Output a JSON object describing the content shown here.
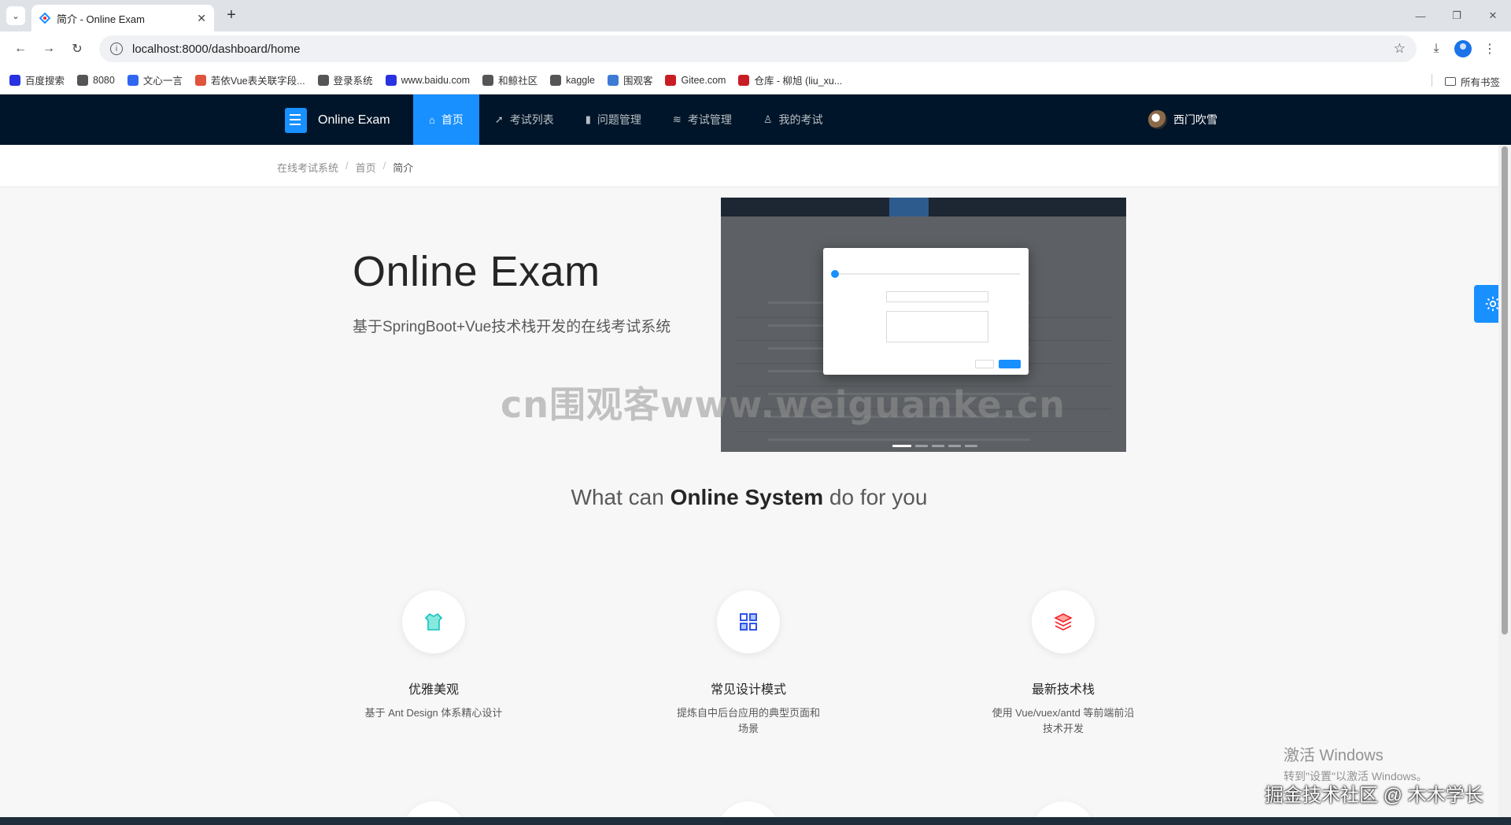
{
  "browser": {
    "tab_title": "简介 - Online Exam",
    "url": "localhost:8000/dashboard/home",
    "bookmarks": [
      {
        "label": "百度搜索",
        "color": "#2932e1"
      },
      {
        "label": "8080",
        "color": "#555555"
      },
      {
        "label": "文心一言",
        "color": "#3066f0"
      },
      {
        "label": "若依Vue表关联字段...",
        "color": "#e0533c"
      },
      {
        "label": "登录系统",
        "color": "#555555"
      },
      {
        "label": "www.baidu.com",
        "color": "#2932e1"
      },
      {
        "label": "和鲸社区",
        "color": "#555555"
      },
      {
        "label": "kaggle",
        "color": "#555555"
      },
      {
        "label": "围观客",
        "color": "#3d7bd6"
      },
      {
        "label": "Gitee.com",
        "color": "#c71d23"
      },
      {
        "label": "仓库 - 柳旭 (liu_xu...",
        "color": "#c71d23"
      }
    ],
    "all_bookmarks": "所有书签"
  },
  "header": {
    "logo_text": "Online Exam",
    "nav": [
      {
        "label": "首页",
        "icon": "home-icon",
        "active": true
      },
      {
        "label": "考试列表",
        "icon": "rocket-icon",
        "active": false
      },
      {
        "label": "问题管理",
        "icon": "book-icon",
        "active": false
      },
      {
        "label": "考试管理",
        "icon": "database-icon",
        "active": false
      },
      {
        "label": "我的考试",
        "icon": "user-icon",
        "active": false
      }
    ],
    "username": "西门吹雪"
  },
  "breadcrumb": [
    "在线考试系统",
    "首页",
    "简介"
  ],
  "hero": {
    "title": "Online Exam",
    "subtitle": "基于SpringBoot+Vue技术栈开发的在线考试系统",
    "carousel_slides": 5,
    "carousel_active": 0
  },
  "watermark": "cn围观客www.weiguanke.cn",
  "section": {
    "prefix": "What can ",
    "bold": "Online System",
    "suffix": " do for you"
  },
  "features": [
    {
      "title": "优雅美观",
      "desc": "基于 Ant Design 体系精心设计",
      "icon": "shirt-icon",
      "color": "#13c2c2"
    },
    {
      "title": "常见设计模式",
      "desc": "提炼自中后台应用的典型页面和场景",
      "icon": "appstore-icon",
      "color": "#2f54eb"
    },
    {
      "title": "最新技术栈",
      "desc": "使用 Vue/vuex/antd 等前端前沿技术开发",
      "icon": "layers-icon",
      "color": "#f5222d"
    }
  ],
  "os": {
    "activate_title": "激活 Windows",
    "activate_sub": "转到\"设置\"以激活 Windows。",
    "credit": "掘金技术社区 @ 木木学长"
  }
}
